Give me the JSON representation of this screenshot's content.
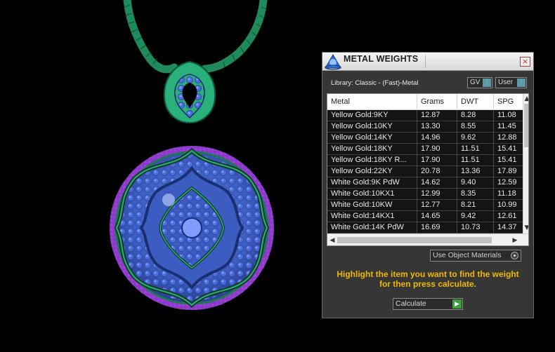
{
  "panel": {
    "title": "METAL WEIGHTS",
    "close_label": "×",
    "library_label": "Library: Classic - (Fast)-Metal",
    "gv_select": "GV",
    "units_select": "User",
    "table": {
      "columns": [
        "Metal",
        "Grams",
        "DWT",
        "SPG"
      ],
      "rows": [
        [
          "Yellow Gold:9KY",
          "12.87",
          "8.28",
          "11.08"
        ],
        [
          "Yellow Gold:10KY",
          "13.30",
          "8.55",
          "11.45"
        ],
        [
          "Yellow Gold:14KY",
          "14.96",
          "9.62",
          "12.88"
        ],
        [
          "Yellow Gold:18KY",
          "17.90",
          "11.51",
          "15.41"
        ],
        [
          "Yellow Gold:18KY R...",
          "17.90",
          "11.51",
          "15.41"
        ],
        [
          "Yellow Gold:22KY",
          "20.78",
          "13.36",
          "17.89"
        ],
        [
          "White Gold:9K PdW",
          "14.62",
          "9.40",
          "12.59"
        ],
        [
          "White Gold:10KX1",
          "12.99",
          "8.35",
          "11.18"
        ],
        [
          "White Gold:10KW",
          "12.77",
          "8.21",
          "10.99"
        ],
        [
          "White Gold:14KX1",
          "14.65",
          "9.42",
          "12.61"
        ],
        [
          "White Gold:14K PdW",
          "16.69",
          "10.73",
          "14.37"
        ]
      ]
    },
    "use_object_materials": "Use Object Materials",
    "instructions": "Highlight the item you want to find the weight for then press calculate.",
    "calculate_label": "Calculate",
    "colors": {
      "instruction_text": "#f0b800",
      "calculate_go": "#39a03a",
      "select_handle": "#5a9aa8"
    }
  },
  "icons": {
    "scroll_up": "▲",
    "scroll_down": "▼",
    "scroll_left": "◀",
    "scroll_right": "▶",
    "calculate_go": "▶",
    "select_handle": "⫶"
  }
}
